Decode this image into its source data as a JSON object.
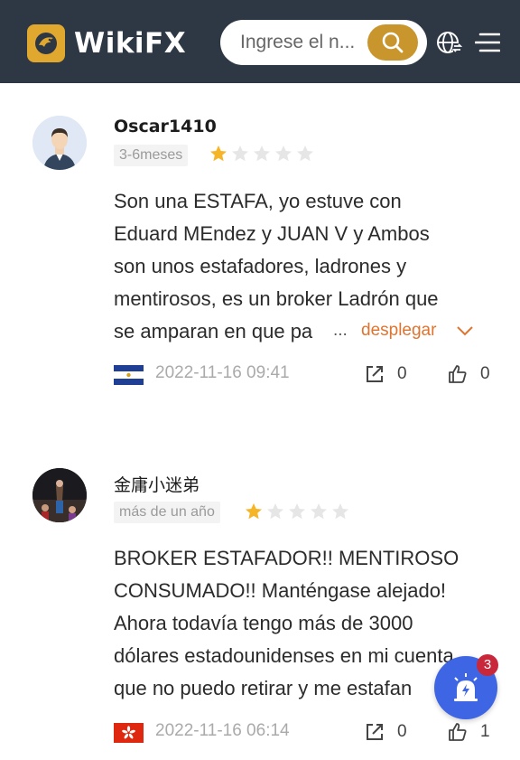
{
  "header": {
    "brand": "WikiFX",
    "search_placeholder": "Ingrese el n...",
    "search_icon": "search-icon",
    "globe_icon": "globe-icon",
    "menu_icon": "menu-icon",
    "brand_color": "#e0a82e",
    "background_color": "#2e3744"
  },
  "reviews": [
    {
      "username": "Oscar1410",
      "period": "3-6meses",
      "rating": 1,
      "rating_max": 5,
      "lines": [
        "Son una ESTAFA, yo estuve con",
        "Eduard MEndez y JUAN V y Ambos",
        "son unos estafadores, ladrones y",
        "mentirosos, es un broker Ladrón que",
        "se amparan en que pa"
      ],
      "ellipsis": "...",
      "expand_label": "desplegar",
      "flag": "el-salvador-flag",
      "date": "2022-11-16 09:41",
      "share_count": "0",
      "like_count": "0"
    },
    {
      "username": "金庸小迷弟",
      "period": "más de un año",
      "rating": 1,
      "rating_max": 5,
      "lines": [
        "BROKER ESTAFADOR!! MENTIROSO",
        "CONSUMADO!! Manténgase alejado!",
        "Ahora todavía tengo más de 3000",
        "dólares estadounidenses en mi cuenta",
        "que no puedo retirar y me estafan"
      ],
      "flag": "hong-kong-flag",
      "date": "2022-11-16 06:14",
      "share_count": "0",
      "like_count": "1"
    }
  ],
  "floating_button": {
    "icon": "alarm-icon",
    "badge": "3",
    "color": "#3e65e4"
  },
  "colors": {
    "star_filled": "#f5b527",
    "star_empty": "#e6e6e6",
    "expand": "#e0742f"
  }
}
